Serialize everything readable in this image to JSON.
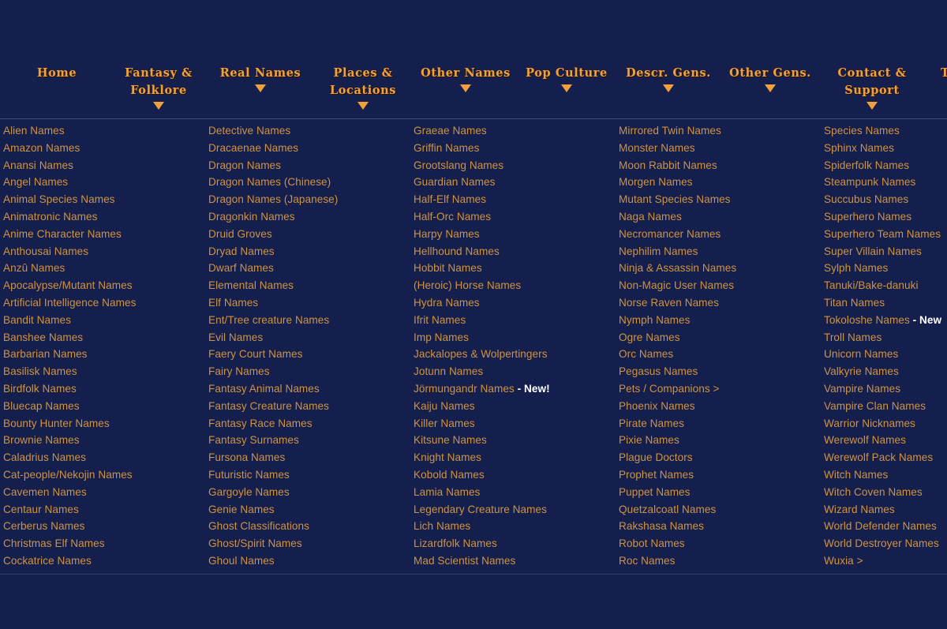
{
  "site": {
    "background_color": "#141f4e",
    "nav_text_color": "#f2a13a",
    "list_text_color": "#cf9340",
    "new_tag_color": "#ffffff"
  },
  "nav": {
    "items": [
      {
        "label": "Home",
        "has_caret": false
      },
      {
        "label": "Fantasy &\nFolklore",
        "line1": "Fantasy &",
        "line2": "Folklore",
        "has_caret": true
      },
      {
        "label": "Real Names",
        "line1": "Real Names",
        "line2": "",
        "has_caret": true
      },
      {
        "label": "Places &\nLocations",
        "line1": "Places &",
        "line2": "Locations",
        "has_caret": true
      },
      {
        "label": "Other Names",
        "line1": "Other Names",
        "line2": "",
        "has_caret": true
      },
      {
        "label": "Pop Culture",
        "line1": "Pop Culture",
        "line2": "",
        "has_caret": true
      },
      {
        "label": "Descr. Gens.",
        "line1": "Descr. Gens.",
        "line2": "",
        "has_caret": true
      },
      {
        "label": "Other Gens.",
        "line1": "Other Gens.",
        "line2": "",
        "has_caret": true
      },
      {
        "label": "Contact &\nSupport",
        "line1": "Contact &",
        "line2": "Support",
        "has_caret": true
      },
      {
        "label": "T",
        "line1": "T",
        "line2": "",
        "has_caret": false,
        "clipped": true
      }
    ]
  },
  "dropdown": {
    "open_for": "Fantasy & Folklore",
    "columns": [
      {
        "items": [
          "Alien Names",
          "Amazon Names",
          "Anansi Names",
          "Angel Names",
          "Animal Species Names",
          "Animatronic Names",
          "Anime Character Names",
          "Anthousai Names",
          "Anzû Names",
          "Apocalypse/Mutant Names",
          "Artificial Intelligence Names",
          "Bandit Names",
          "Banshee Names",
          "Barbarian Names",
          "Basilisk Names",
          "Birdfolk Names",
          "Bluecap Names",
          "Bounty Hunter Names",
          "Brownie Names",
          "Caladrius Names",
          "Cat-people/Nekojin Names",
          "Cavemen Names",
          "Centaur Names",
          "Cerberus Names",
          "Christmas Elf Names",
          "Cockatrice Names"
        ]
      },
      {
        "items": [
          "Detective Names",
          "Dracaenae Names",
          "Dragon Names",
          "Dragon Names (Chinese)",
          "Dragon Names (Japanese)",
          "Dragonkin Names",
          "Druid Groves",
          "Dryad Names",
          "Dwarf Names",
          "Elemental Names",
          "Elf Names",
          "Ent/Tree creature Names",
          "Evil Names",
          "Faery Court Names",
          "Fairy Names",
          "Fantasy Animal Names",
          "Fantasy Creature Names",
          "Fantasy Race Names",
          "Fantasy Surnames",
          "Fursona Names",
          "Futuristic Names",
          "Gargoyle Names",
          "Genie Names",
          "Ghost Classifications",
          "Ghost/Spirit Names",
          "Ghoul Names"
        ]
      },
      {
        "items": [
          "Graeae Names",
          "Griffin Names",
          "Grootslang Names",
          "Guardian Names",
          "Half-Elf Names",
          "Half-Orc Names",
          "Harpy Names",
          "Hellhound Names",
          "Hobbit Names",
          "(Heroic) Horse Names",
          "Hydra Names",
          "Ifrit Names",
          "Imp Names",
          "Jackalopes & Wolpertingers",
          "Jotunn Names",
          {
            "text": "Jörmungandr Names",
            "tag": " - New!"
          },
          "Kaiju Names",
          "Killer Names",
          "Kitsune Names",
          "Knight Names",
          "Kobold Names",
          "Lamia Names",
          "Legendary Creature Names",
          "Lich Names",
          "Lizardfolk Names",
          "Mad Scientist Names"
        ]
      },
      {
        "items": [
          "Mirrored Twin Names",
          "Monster Names",
          "Moon Rabbit Names",
          "Morgen Names",
          "Mutant Species Names",
          "Naga Names",
          "Necromancer Names",
          "Nephilim Names",
          "Ninja & Assassin Names",
          "Non-Magic User Names",
          "Norse Raven Names",
          "Nymph Names",
          "Ogre Names",
          "Orc Names",
          "Pegasus Names",
          "Pets / Companions >",
          "Phoenix Names",
          "Pirate Names",
          "Pixie Names",
          "Plague Doctors",
          "Prophet Names",
          "Puppet Names",
          "Quetzalcoatl Names",
          "Rakshasa Names",
          "Robot Names",
          "Roc Names"
        ]
      },
      {
        "items": [
          "Species Names",
          "Sphinx Names",
          "Spiderfolk Names",
          "Steampunk Names",
          "Succubus Names",
          "Superhero Names",
          "Superhero Team Names",
          "Super Villain Names",
          "Sylph Names",
          "Tanuki/Bake-danuki",
          "Titan Names",
          {
            "text": "Tokoloshe Names",
            "tag": " - New"
          },
          "Troll Names",
          "Unicorn Names",
          "Valkyrie Names",
          "Vampire Names",
          "Vampire Clan Names",
          "Warrior Nicknames",
          "Werewolf Names",
          "Werewolf Pack Names",
          "Witch Names",
          "Witch Coven Names",
          "Wizard Names",
          "World Defender Names",
          "World Destroyer Names",
          "Wuxia >"
        ]
      }
    ]
  }
}
